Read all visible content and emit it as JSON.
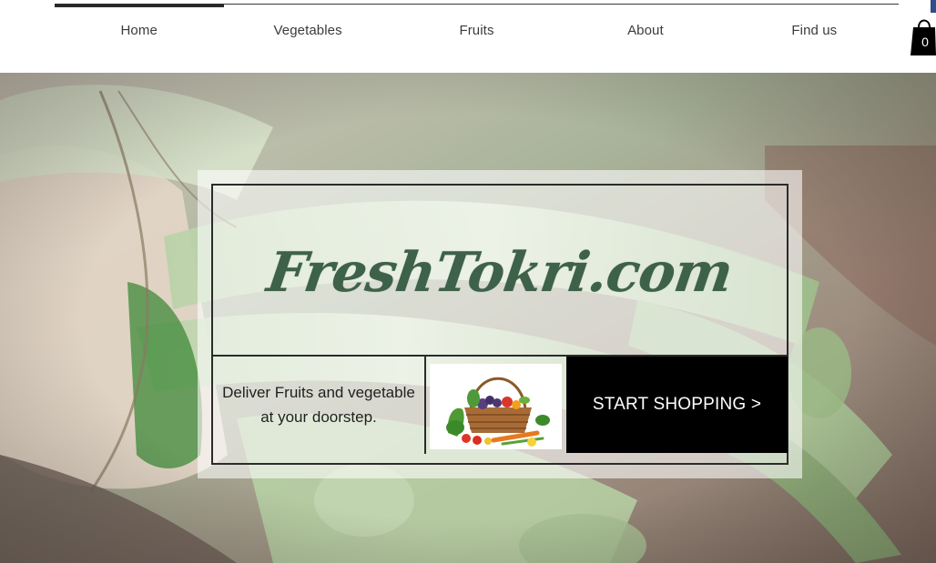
{
  "nav": {
    "items": [
      {
        "label": "Home",
        "active": true
      },
      {
        "label": "Vegetables"
      },
      {
        "label": "Fruits"
      },
      {
        "label": "About"
      },
      {
        "label": "Find us"
      }
    ]
  },
  "cart": {
    "count": "0",
    "icon": "shopping-bag-icon"
  },
  "hero": {
    "brand": "FreshTokri.com",
    "tagline": "Deliver Fruits and vegetable at your doorstep.",
    "cta_label": "START SHOPPING >",
    "image": "fruit-vegetable-basket"
  },
  "colors": {
    "brand_green": "#3e6149",
    "cta_background": "#000000",
    "nav_text": "#3b3b3b"
  }
}
